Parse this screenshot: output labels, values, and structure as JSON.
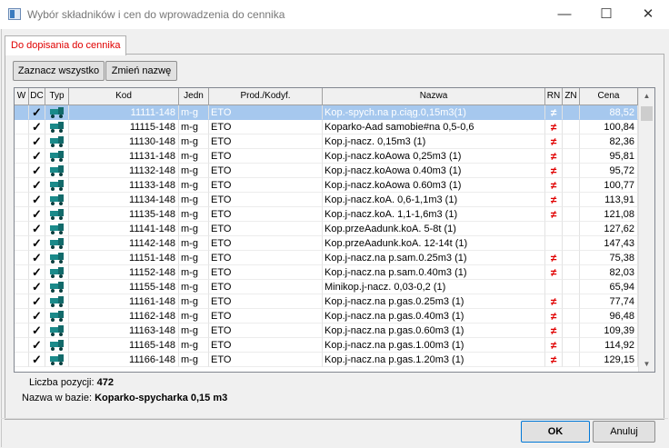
{
  "window": {
    "title": "Wybór składników i cen do wprowadzenia do cennika",
    "minimize": "—",
    "maximize": "☐",
    "close": "✕"
  },
  "tab": {
    "label": "Do dopisania do cennika"
  },
  "toolbar": {
    "select_all": "Zaznacz wszystko",
    "rename": "Zmień nazwę"
  },
  "columns": [
    "W",
    "DC",
    "Typ",
    "Kod",
    "Jedn",
    "Prod./Kodyf.",
    "Nazwa",
    "RN",
    "ZN",
    "Cena"
  ],
  "rows": [
    {
      "code": "11111-148",
      "unit": "m-g",
      "prod": "ETO",
      "name": "Kop.-spych.na p.ciąg.0,15m3(1)",
      "rn": "≠",
      "price": "88,52",
      "selected": true
    },
    {
      "code": "11115-148",
      "unit": "m-g",
      "prod": "ETO",
      "name": "Koparko-Aad samobie#na 0,5-0,6",
      "rn": "≠",
      "price": "100,84"
    },
    {
      "code": "11130-148",
      "unit": "m-g",
      "prod": "ETO",
      "name": "Kop.j-nacz. 0,15m3  (1)",
      "rn": "≠",
      "price": "82,36"
    },
    {
      "code": "11131-148",
      "unit": "m-g",
      "prod": "ETO",
      "name": "Kop.j-nacz.koAowa 0,25m3 (1)",
      "rn": "≠",
      "price": "95,81"
    },
    {
      "code": "11132-148",
      "unit": "m-g",
      "prod": "ETO",
      "name": "Kop.j-nacz.koAowa 0.40m3 (1)",
      "rn": "≠",
      "price": "95,72"
    },
    {
      "code": "11133-148",
      "unit": "m-g",
      "prod": "ETO",
      "name": "Kop.j-nacz.koAowa 0.60m3 (1)",
      "rn": "≠",
      "price": "100,77"
    },
    {
      "code": "11134-148",
      "unit": "m-g",
      "prod": "ETO",
      "name": "Kop.j-nacz.koA. 0,6-1,1m3 (1)",
      "rn": "≠",
      "price": "113,91"
    },
    {
      "code": "11135-148",
      "unit": "m-g",
      "prod": "ETO",
      "name": "Kop.j-nacz.koA. 1,1-1,6m3 (1)",
      "rn": "≠",
      "price": "121,08"
    },
    {
      "code": "11141-148",
      "unit": "m-g",
      "prod": "ETO",
      "name": "Kop.przeAadunk.koA. 5-8t (1)",
      "rn": "",
      "price": "127,62"
    },
    {
      "code": "11142-148",
      "unit": "m-g",
      "prod": "ETO",
      "name": "Kop.przeAadunk.koA. 12-14t (1)",
      "rn": "",
      "price": "147,43"
    },
    {
      "code": "11151-148",
      "unit": "m-g",
      "prod": "ETO",
      "name": "Kop.j-nacz.na p.sam.0.25m3 (1)",
      "rn": "≠",
      "price": "75,38"
    },
    {
      "code": "11152-148",
      "unit": "m-g",
      "prod": "ETO",
      "name": "Kop.j-nacz.na p.sam.0.40m3 (1)",
      "rn": "≠",
      "price": "82,03"
    },
    {
      "code": "11155-148",
      "unit": "m-g",
      "prod": "ETO",
      "name": "Minikop.j-nacz. 0,03-0,2 (1)",
      "rn": "",
      "price": "65,94"
    },
    {
      "code": "11161-148",
      "unit": "m-g",
      "prod": "ETO",
      "name": "Kop.j-nacz.na p.gas.0.25m3 (1)",
      "rn": "≠",
      "price": "77,74"
    },
    {
      "code": "11162-148",
      "unit": "m-g",
      "prod": "ETO",
      "name": "Kop.j-nacz.na p.gas.0.40m3 (1)",
      "rn": "≠",
      "price": "96,48"
    },
    {
      "code": "11163-148",
      "unit": "m-g",
      "prod": "ETO",
      "name": "Kop.j-nacz.na p.gas.0.60m3 (1)",
      "rn": "≠",
      "price": "109,39"
    },
    {
      "code": "11165-148",
      "unit": "m-g",
      "prod": "ETO",
      "name": "Kop.j-nacz.na p.gas.1.00m3 (1)",
      "rn": "≠",
      "price": "114,92"
    },
    {
      "code": "11166-148",
      "unit": "m-g",
      "prod": "ETO",
      "name": "Kop.j-nacz.na p.gas.1.20m3 (1)",
      "rn": "≠",
      "price": "129,15"
    }
  ],
  "info": {
    "count_label": "Liczba pozycji:",
    "count_value": "472",
    "name_label": "Nazwa w bazie:",
    "name_value": "Koparko-spycharka 0,15 m3"
  },
  "footer": {
    "ok": "OK",
    "cancel": "Anuluj"
  },
  "colors": {
    "tab_text": "#e00000",
    "selection": "#a6c8ee",
    "rn_mark": "#e00000",
    "truck": "#1a8a8a"
  }
}
